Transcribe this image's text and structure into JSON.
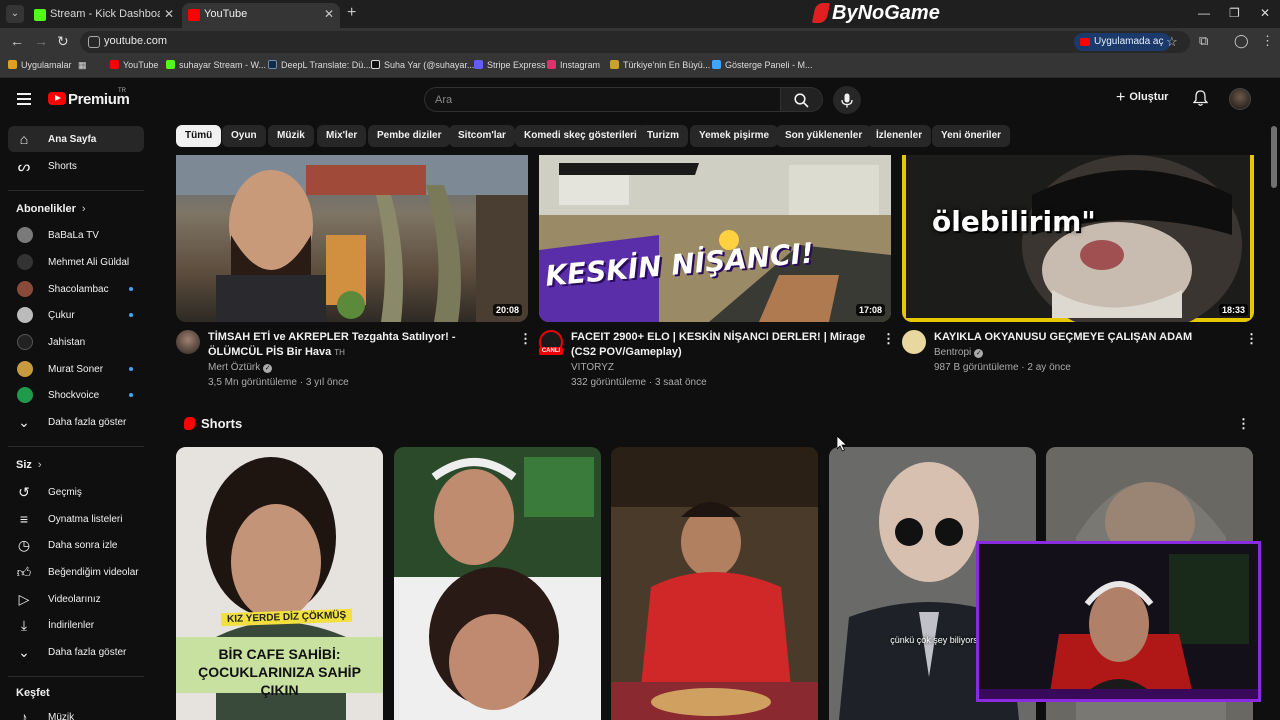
{
  "browser": {
    "tabs": [
      {
        "title": "Stream - Kick Dashboard",
        "favicon_color": "#53fc18"
      },
      {
        "title": "YouTube",
        "favicon_color": "#ff0000"
      }
    ],
    "brand_overlay": "ByNoGame",
    "url": "youtube.com",
    "open_in_app_label": "Uygulamada aç",
    "bookmarks": [
      {
        "label": "Uygulamalar",
        "icon": "apps-grid-icon",
        "color": "#e0a020"
      },
      {
        "label": "YouTube",
        "icon": "youtube-icon",
        "color": "#ff0000"
      },
      {
        "label": "suhayar Stream - W...",
        "icon": "kick-icon",
        "color": "#53fc18"
      },
      {
        "label": "DeepL Translate: Dü...",
        "icon": "deepl-icon",
        "color": "#0f2b46"
      },
      {
        "label": "Suha Yar (@suhayar...",
        "icon": "tiktok-icon",
        "color": "#ffffff"
      },
      {
        "label": "Stripe Express",
        "icon": "stripe-icon",
        "color": "#635bff"
      },
      {
        "label": "Instagram",
        "icon": "instagram-icon",
        "color": "#e1306c"
      },
      {
        "label": "Türkiye'nin En Büyü...",
        "icon": "site-icon",
        "color": "#c9a227"
      },
      {
        "label": "Gösterge Paneli - M...",
        "icon": "dashboard-icon",
        "color": "#3ea6ff"
      }
    ]
  },
  "header": {
    "brand": "Premium",
    "region": "TR",
    "search_placeholder": "Ara",
    "create_label": "Oluştur"
  },
  "sidebar": {
    "main": [
      {
        "label": "Ana Sayfa",
        "icon": "home-icon",
        "active": true
      },
      {
        "label": "Shorts",
        "icon": "shorts-icon",
        "active": false
      }
    ],
    "subscriptions_title": "Abonelikler",
    "subscriptions": [
      {
        "label": "BaBaLa TV",
        "new": false,
        "color": "#7a7a7a"
      },
      {
        "label": "Mehmet Ali Güldal",
        "new": false,
        "color": "#333333"
      },
      {
        "label": "Shacolambac",
        "new": true,
        "color": "#8a4a3a"
      },
      {
        "label": "Çukur",
        "new": true,
        "color": "#bbbbbb"
      },
      {
        "label": "Jahistan",
        "new": false,
        "color": "#222222"
      },
      {
        "label": "Murat Soner",
        "new": true,
        "color": "#c89a40"
      },
      {
        "label": "Shockvoice",
        "new": true,
        "color": "#1f9a4a"
      }
    ],
    "show_more_label": "Daha fazla göster",
    "you_title": "Siz",
    "you_items": [
      {
        "label": "Geçmiş",
        "icon": "history-icon"
      },
      {
        "label": "Oynatma listeleri",
        "icon": "playlists-icon"
      },
      {
        "label": "Daha sonra izle",
        "icon": "watch-later-icon"
      },
      {
        "label": "Beğendiğim videolar",
        "icon": "liked-icon"
      },
      {
        "label": "Videolarınız",
        "icon": "your-videos-icon"
      },
      {
        "label": "İndirilenler",
        "icon": "downloads-icon"
      },
      {
        "label": "Daha fazla göster",
        "icon": "chevron-down-icon"
      }
    ],
    "explore_title": "Keşfet",
    "explore_items": [
      {
        "label": "Müzik",
        "icon": "music-icon"
      }
    ]
  },
  "chips": [
    "Tümü",
    "Oyun",
    "Müzik",
    "Mix'ler",
    "Pembe diziler",
    "Sitcom'lar",
    "Komedi skeç gösterileri",
    "Turizm",
    "Yemek pişirme",
    "Son yüklenenler",
    "İzlenenler",
    "Yeni öneriler"
  ],
  "videos": [
    {
      "title": "TİMSAH ETİ ve AKREPLER Tezgahta Satılıyor! - ÖLÜMCÜL PİS Bir Hava",
      "title_tag": "TH",
      "channel": "Mert Öztürk",
      "verified": true,
      "meta": "3,5 Mn görüntüleme · 3 yıl önce",
      "duration": "20:08"
    },
    {
      "title": "FACEIT 2900+ ELO | KESKİN NİŞANCI DERLER! | Mirage (CS2 POV/Gameplay)",
      "channel": "VITORYZ",
      "verified": false,
      "meta": "332 görüntüleme · 3 saat önce",
      "duration": "17:08",
      "thumb_text": "KESKİN NİŞANCI!",
      "live_badge": "CANLI"
    },
    {
      "title": "KAYIKLA OKYANUSU GEÇMEYE ÇALIŞAN ADAM",
      "channel": "Bentropi",
      "verified": true,
      "meta": "987 B görüntüleme · 2 ay önce",
      "duration": "18:33",
      "thumb_text": "ölebilirim\""
    }
  ],
  "shorts": {
    "title": "Shorts",
    "items": [
      {
        "caption_top": "KIZ YERDE DİZ ÇÖKMÜŞ",
        "caption": "BİR CAFE SAHİBİ: ÇOCUKLARINIZA SAHİP ÇIKIN"
      },
      {
        "caption": ""
      },
      {
        "caption": ""
      },
      {
        "caption": "çünkü çok şey biliyorsun"
      },
      {
        "caption": ""
      }
    ]
  }
}
